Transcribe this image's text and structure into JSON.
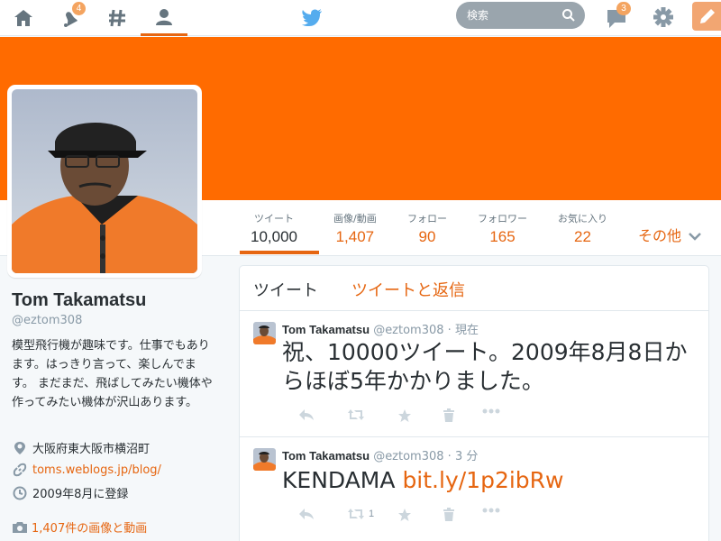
{
  "nav": {
    "notifications_count": "4",
    "dm_count": "3",
    "search_placeholder": "検索"
  },
  "colors": {
    "accent": "#e66611",
    "banner": "#ff6b00",
    "badge": "#f4a460"
  },
  "profile": {
    "name": "Tom Takamatsu",
    "handle": "@eztom308",
    "bio": "模型飛行機が趣味です。仕事でもあります。はっきり言って、楽しんでます。 まだまだ、飛ばしてみたい機体や作ってみたい機体が沢山あります。",
    "location": "大阪府東大阪市横沼町",
    "url": "toms.weblogs.jp/blog/",
    "joined": "2009年8月に登録",
    "photos_link": "1,407件の画像と動画"
  },
  "stats": [
    {
      "label": "ツイート",
      "value": "10,000"
    },
    {
      "label": "画像/動画",
      "value": "1,407"
    },
    {
      "label": "フォロー",
      "value": "90"
    },
    {
      "label": "フォロワー",
      "value": "165"
    },
    {
      "label": "お気に入り",
      "value": "22"
    }
  ],
  "more_label": "その他",
  "timeline_tabs": {
    "tweets": "ツイート",
    "tweets_replies": "ツイートと返信"
  },
  "tweets": [
    {
      "name": "Tom Takamatsu",
      "handle": "@eztom308",
      "sep": " · ",
      "time": "現在",
      "text": "祝、10000ツイート。2009年8月8日からほぼ5年かかりました。",
      "link": "",
      "retweet_count": ""
    },
    {
      "name": "Tom Takamatsu",
      "handle": "@eztom308",
      "sep": " · ",
      "time": "3 分",
      "text": "KENDAMA ",
      "link": "bit.ly/1p2ibRw",
      "retweet_count": "1"
    }
  ]
}
